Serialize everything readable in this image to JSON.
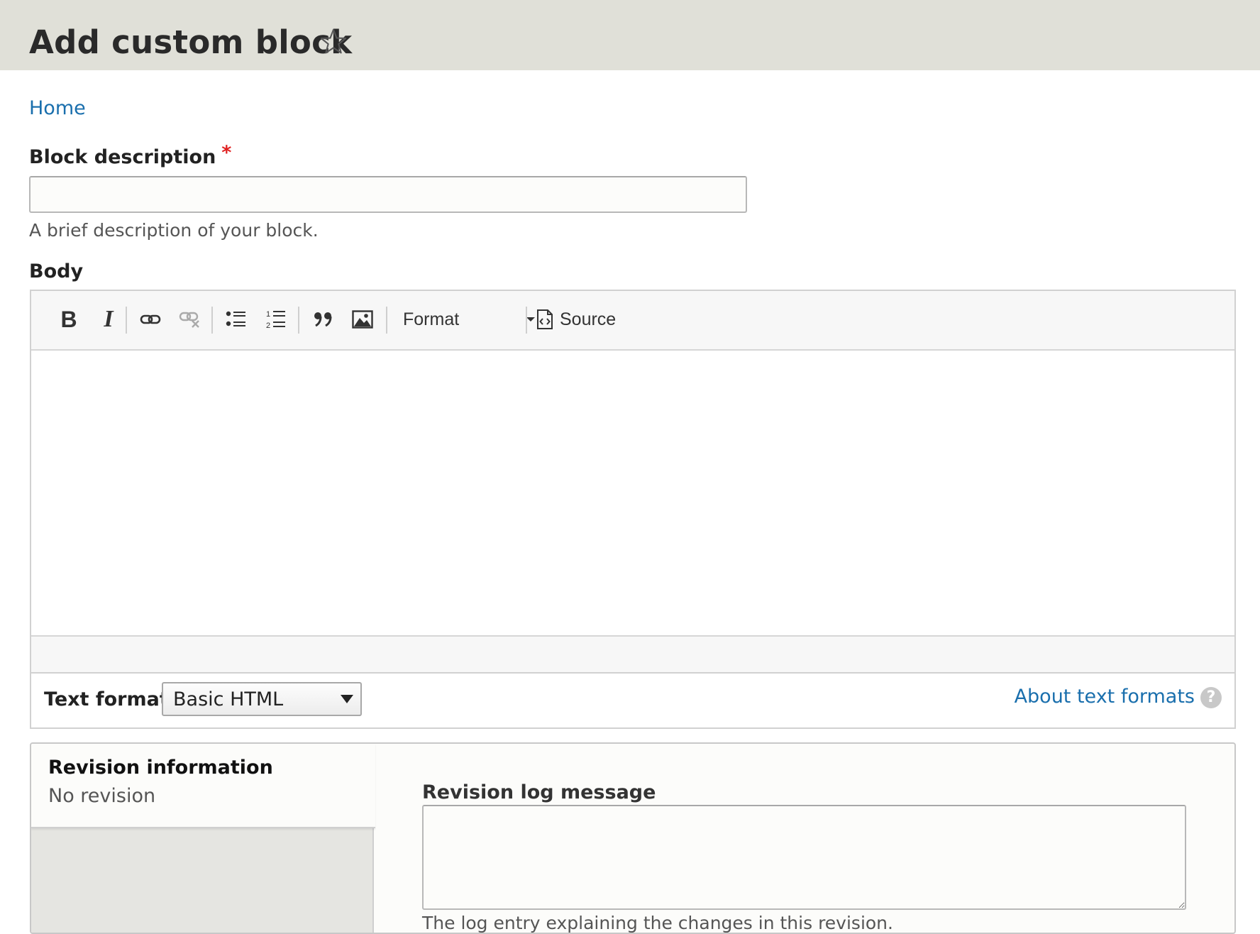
{
  "page": {
    "title": "Add custom block",
    "shortcut_icon": "star-outline-icon"
  },
  "breadcrumb": {
    "home": "Home"
  },
  "block_description": {
    "label": "Block description",
    "required_marker": "*",
    "value": "",
    "help": "A brief description of your block."
  },
  "body": {
    "label": "Body",
    "toolbar": {
      "bold": "B",
      "italic": "I",
      "link_icon": "link-icon",
      "unlink_icon": "unlink-icon",
      "bulleted_list_icon": "bulleted-list-icon",
      "numbered_list_icon": "numbered-list-icon",
      "blockquote_icon": "blockquote-icon",
      "image_icon": "image-icon",
      "format_label": "Format",
      "source_label": "Source"
    },
    "content": ""
  },
  "text_format": {
    "label": "Text format",
    "selected": "Basic HTML",
    "about_link": "About text formats",
    "help_glyph": "?"
  },
  "revision": {
    "tab_title": "Revision information",
    "tab_summary": "No revision",
    "log_label": "Revision log message",
    "log_value": "",
    "log_help": "The log entry explaining the changes in this revision."
  },
  "colors": {
    "header_bg": "#e0e0d8",
    "link": "#1a6fad",
    "required": "#e02020"
  }
}
